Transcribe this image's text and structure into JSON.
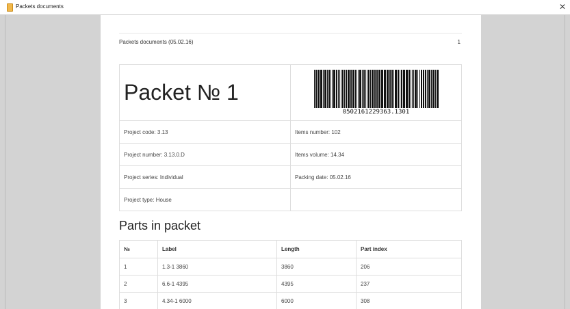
{
  "window": {
    "title": "Packets documents",
    "icon": "document-icon",
    "close_label": "✕"
  },
  "page_header": {
    "title": "Packets documents (05.02.16)",
    "page_number": "1"
  },
  "packet": {
    "title": "Packet № 1",
    "barcode_number": "0502161229363.1301"
  },
  "info": {
    "project_code": "Project code: 3.13",
    "items_number": "Items number: 102",
    "project_number": "Project number: 3.13.0.D",
    "items_volume": "Items volume: 14.34",
    "project_series": "Project series: Individual",
    "packing_date": "Packing date: 05.02.16",
    "project_type": "Project type: House"
  },
  "parts": {
    "title": "Parts in packet",
    "headers": [
      "№",
      "Label",
      "Length",
      "Part index"
    ],
    "rows": [
      [
        "1",
        "1.3-1 3860",
        "3860",
        "206"
      ],
      [
        "2",
        "6.6-1 4395",
        "4395",
        "237"
      ],
      [
        "3",
        "4.34-1 6000",
        "6000",
        "308"
      ]
    ]
  }
}
